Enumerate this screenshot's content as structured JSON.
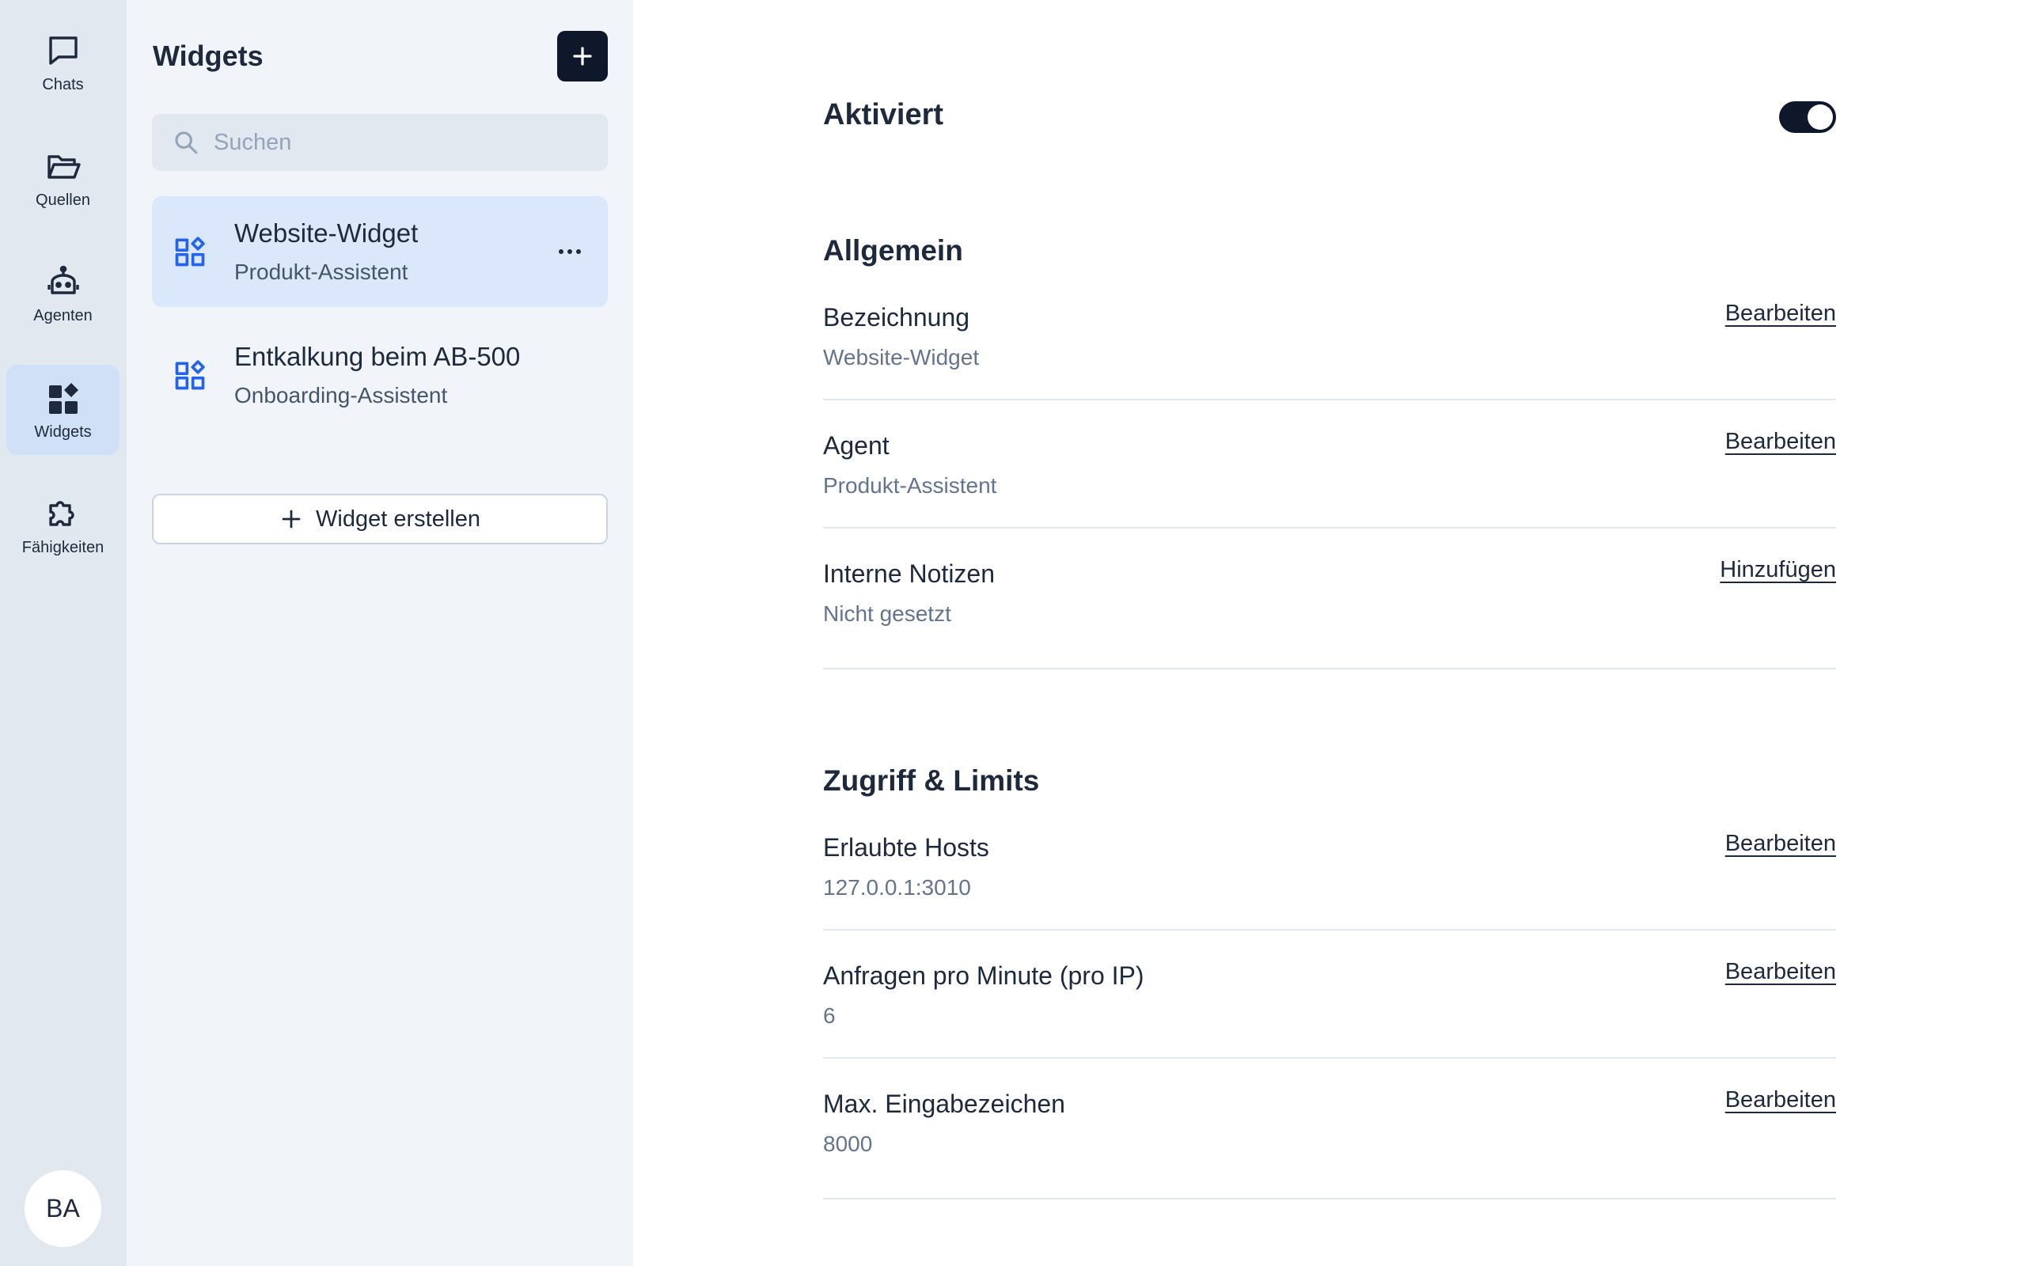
{
  "rail": {
    "items": [
      {
        "label": "Chats",
        "icon": "chat-icon"
      },
      {
        "label": "Quellen",
        "icon": "folder-icon"
      },
      {
        "label": "Agenten",
        "icon": "robot-icon"
      },
      {
        "label": "Widgets",
        "icon": "widgets-icon",
        "active": true
      },
      {
        "label": "Fähigkeiten",
        "icon": "puzzle-icon"
      }
    ],
    "avatar": "BA"
  },
  "panel": {
    "title": "Widgets",
    "search_placeholder": "Suchen",
    "items": [
      {
        "title": "Website-Widget",
        "subtitle": "Produkt-Assistent",
        "active": true
      },
      {
        "title": "Entkalkung beim AB-500",
        "subtitle": "Onboarding-Assistent",
        "active": false
      }
    ],
    "create_label": "Widget erstellen"
  },
  "main": {
    "enabled_label": "Aktiviert",
    "enabled": true,
    "sections": [
      {
        "title": "Allgemein",
        "rows": [
          {
            "label": "Bezeichnung",
            "value": "Website-Widget",
            "action": "Bearbeiten"
          },
          {
            "label": "Agent",
            "value": "Produkt-Assistent",
            "action": "Bearbeiten"
          },
          {
            "label": "Interne Notizen",
            "value": "Nicht gesetzt",
            "action": "Hinzufügen"
          }
        ]
      },
      {
        "title": "Zugriff & Limits",
        "rows": [
          {
            "label": "Erlaubte Hosts",
            "value": "127.0.0.1:3010",
            "action": "Bearbeiten"
          },
          {
            "label": "Anfragen pro Minute (pro IP)",
            "value": "6",
            "action": "Bearbeiten"
          },
          {
            "label": "Max. Eingabezeichen",
            "value": "8000",
            "action": "Bearbeiten"
          }
        ]
      }
    ]
  },
  "colors": {
    "rail_bg": "#e2e8f0",
    "panel_bg": "#f1f5f9",
    "active_item_bg": "#dbe8fb",
    "accent_icon": "#2563eb",
    "dark": "#0f172a"
  }
}
